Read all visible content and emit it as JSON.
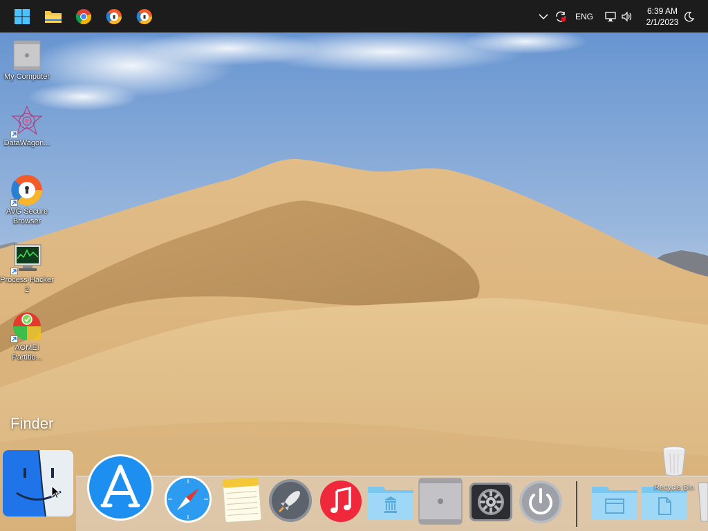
{
  "taskbar": {
    "pinned": [
      {
        "name": "start-button",
        "icon": "windows-icon"
      },
      {
        "name": "file-explorer-button",
        "icon": "folder-icon"
      },
      {
        "name": "chrome-button",
        "icon": "chrome-icon"
      },
      {
        "name": "avg-browser-button-1",
        "icon": "avg-secure-browser-icon"
      },
      {
        "name": "avg-browser-button-2",
        "icon": "avg-secure-browser-icon"
      }
    ],
    "tray": {
      "language": "ENG",
      "time": "6:39 AM",
      "date": "2/1/2023"
    }
  },
  "desktop_icons": [
    {
      "label": "My Computer",
      "icon": "mac-pro-icon",
      "shortcut": false
    },
    {
      "label": "DataWagon...",
      "icon": "datawagon-icon",
      "shortcut": true
    },
    {
      "label": "AVG Secure Browser",
      "icon": "avg-secure-browser-icon",
      "shortcut": true
    },
    {
      "label": "Process Hacker 2",
      "icon": "process-hacker-icon",
      "shortcut": true
    },
    {
      "label": "AOMEI Partitio...",
      "icon": "aomei-partition-icon",
      "shortcut": true
    }
  ],
  "dock": {
    "active_app_label": "Finder",
    "items": [
      "finder-icon",
      "app-store-icon",
      "safari-icon",
      "notes-icon",
      "launchpad-icon",
      "music-icon",
      "applications-folder-icon",
      "mac-pro-icon",
      "system-preferences-icon",
      "power-icon",
      "downloads-folder-icon",
      "documents-folder-icon",
      "trash-icon"
    ]
  },
  "recycle_bin": {
    "label": "Recycle Bin"
  },
  "colors": {
    "taskbar": "#1c1c1c",
    "sky_top": "#5e8fcf",
    "sand": "#d9b27e",
    "app_store_blue": "#1d8ff0",
    "music_red": "#f0283c",
    "folder_blue": "#8fd3f5"
  }
}
